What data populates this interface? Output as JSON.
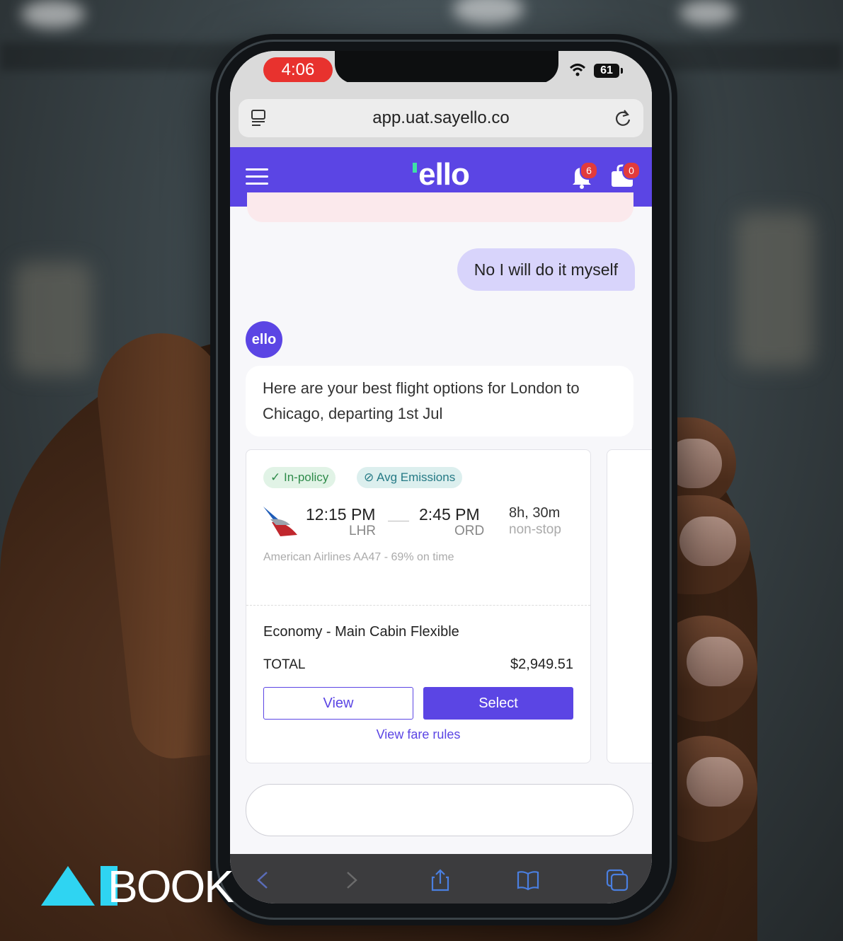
{
  "status_bar": {
    "time": "4:06",
    "battery": "61"
  },
  "browser": {
    "url": "app.uat.sayello.co"
  },
  "app": {
    "logo": "ello",
    "notifications_count": "6",
    "bag_count": "0",
    "avatar_label": "ello"
  },
  "chat": {
    "user_message": "No I will do it myself",
    "bot_message": "Here are your best flight options for London to Chicago, departing 1st Jul"
  },
  "flight_card": {
    "tags": [
      "In-policy",
      "Avg Emissions"
    ],
    "departure_time": "12:15 PM",
    "departure_code": "LHR",
    "arrival_time": "2:45 PM",
    "arrival_code": "ORD",
    "duration": "8h, 30m",
    "stops": "non-stop",
    "flight_info": "American Airlines AA47 - 69% on time",
    "fare_class": "Economy - Main Cabin Flexible",
    "total_label": "TOTAL",
    "total_value": "$2,949.51",
    "view_label": "View",
    "select_label": "Select",
    "fare_rules_label": "View fare rules"
  },
  "brand_overlay": {
    "word": "BOOK"
  },
  "colors": {
    "primary": "#5b45e4",
    "accent": "#2fd4f2",
    "time_pill": "#e8322e"
  }
}
